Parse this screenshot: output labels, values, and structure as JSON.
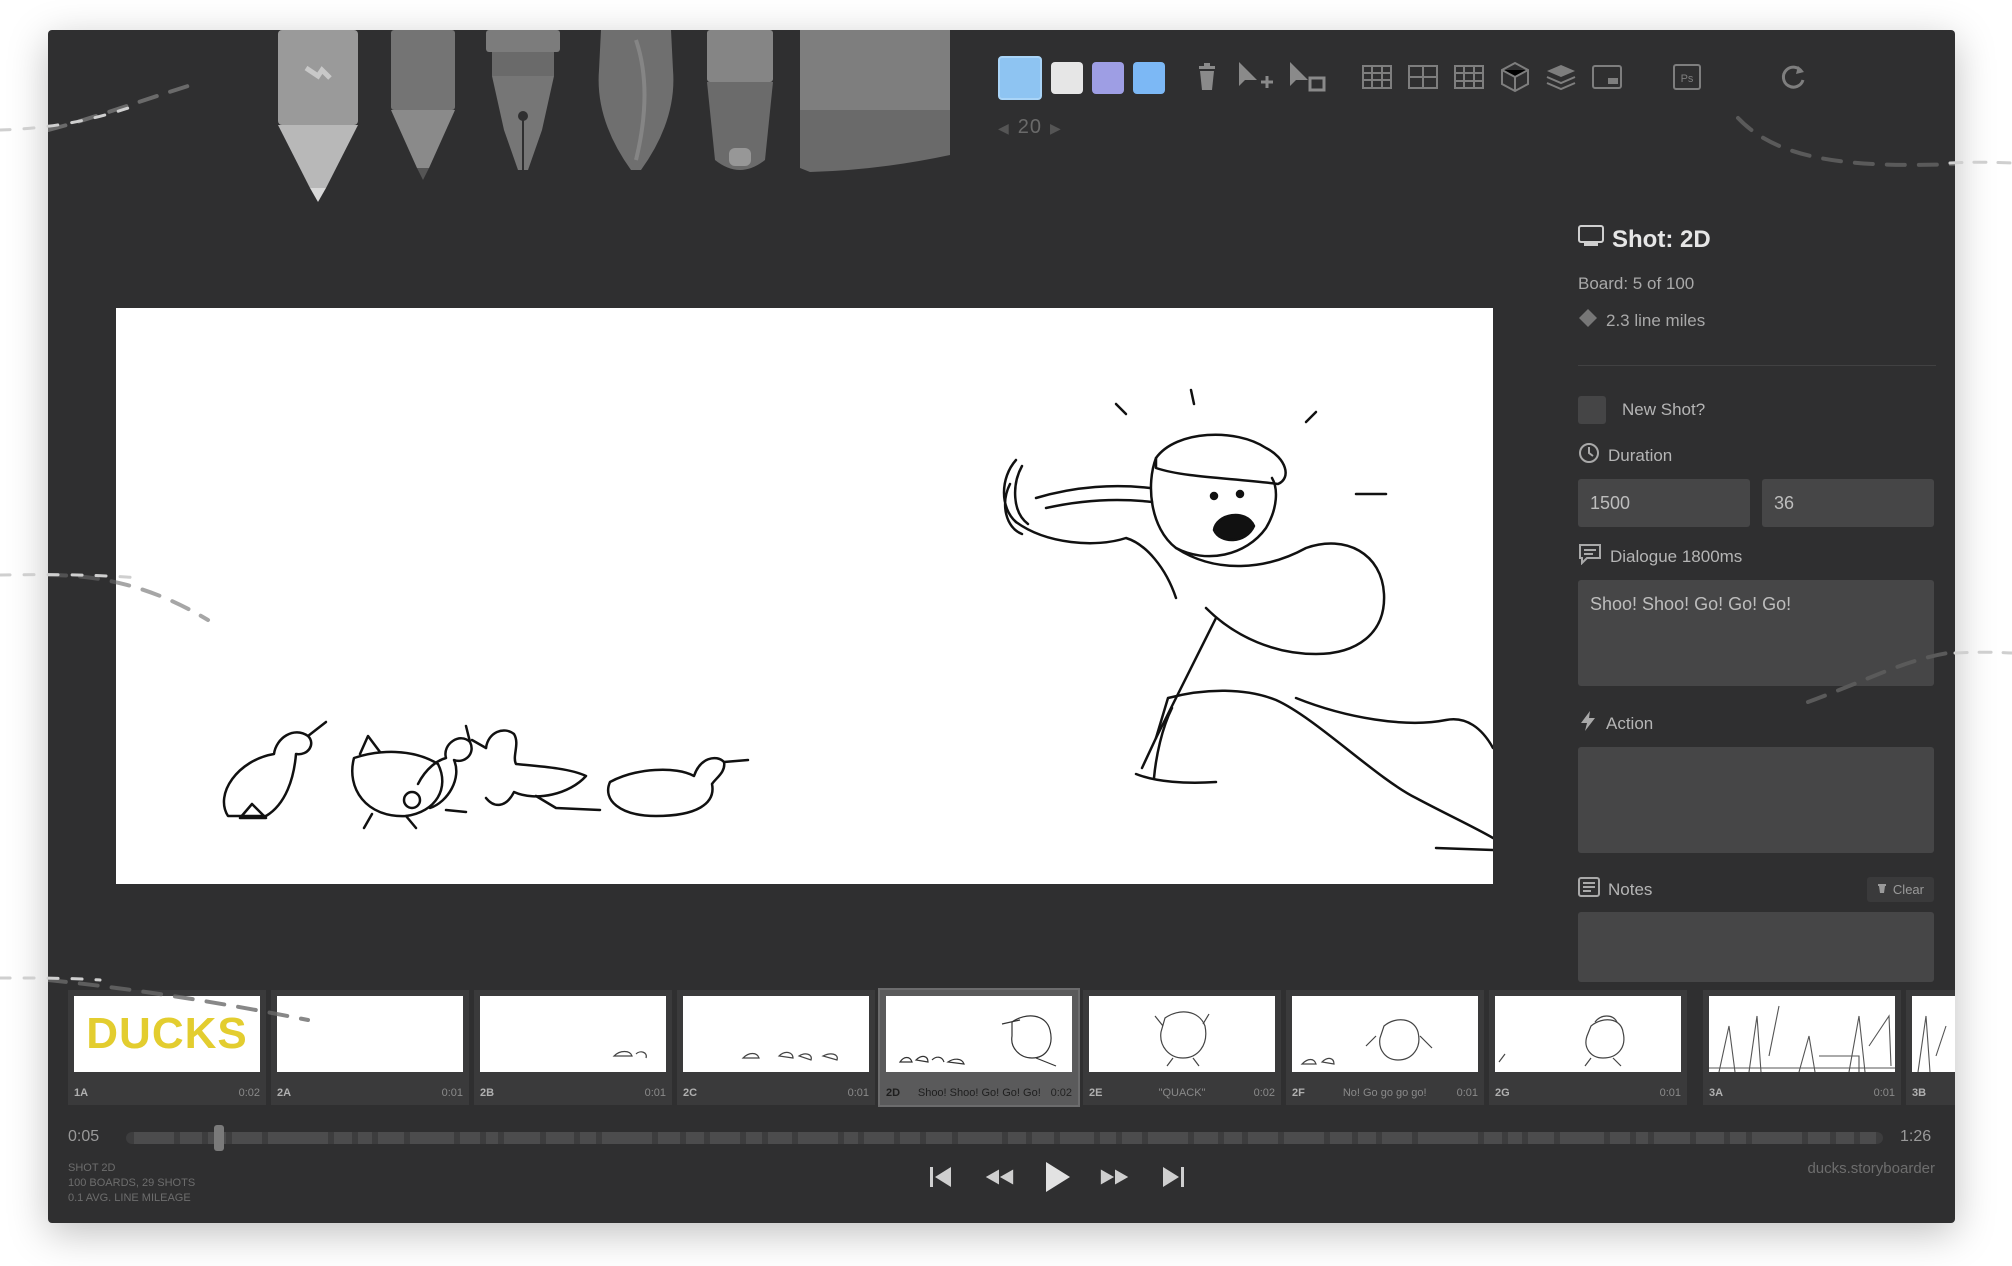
{
  "toolbar": {
    "brush_size": "20",
    "swatches": [
      "#8ec4f2",
      "#e6e6e6",
      "#9e9ee4",
      "#7cb8f5"
    ],
    "tools": [
      "light-pencil",
      "pencil",
      "pen",
      "brush",
      "note-pen",
      "eraser"
    ]
  },
  "panel": {
    "shot_title": "Shot: 2D",
    "board_meta": "Board: 5 of 100",
    "line_miles": "2.3 line miles",
    "new_shot_label": "New Shot?",
    "duration_label": "Duration",
    "duration_ms": "1500",
    "duration_frames": "36",
    "dialogue_label": "Dialogue 1800ms",
    "dialogue_text": "Shoo! Shoo! Go! Go! Go!",
    "action_label": "Action",
    "action_text": "",
    "notes_label": "Notes",
    "notes_text": "",
    "clear_label": "Clear"
  },
  "boards": [
    {
      "num": "1A",
      "dialogue": "",
      "time": "0:02",
      "title_art": "DUCKS"
    },
    {
      "num": "2A",
      "dialogue": "",
      "time": "0:01"
    },
    {
      "num": "2B",
      "dialogue": "",
      "time": "0:01"
    },
    {
      "num": "2C",
      "dialogue": "",
      "time": "0:01"
    },
    {
      "num": "2D",
      "dialogue": "Shoo! Shoo! Go! Go! Go!",
      "time": "0:02",
      "current": true
    },
    {
      "num": "2E",
      "dialogue": "\"QUACK\"",
      "time": "0:02"
    },
    {
      "num": "2F",
      "dialogue": "No! Go go go go!",
      "time": "0:01"
    },
    {
      "num": "2G",
      "dialogue": "",
      "time": "0:01"
    },
    {
      "num": "3A",
      "dialogue": "",
      "time": "0:01"
    },
    {
      "num": "3B",
      "dialogue": "",
      "time": ""
    }
  ],
  "timeline": {
    "current_time": "0:05",
    "total_time": "1:26"
  },
  "stats": {
    "line1": "SHOT 2D",
    "line2": "100 BOARDS, 29 SHOTS",
    "line3": "0.1 AVG. LINE MILEAGE"
  },
  "filename": "ducks.storyboarder"
}
